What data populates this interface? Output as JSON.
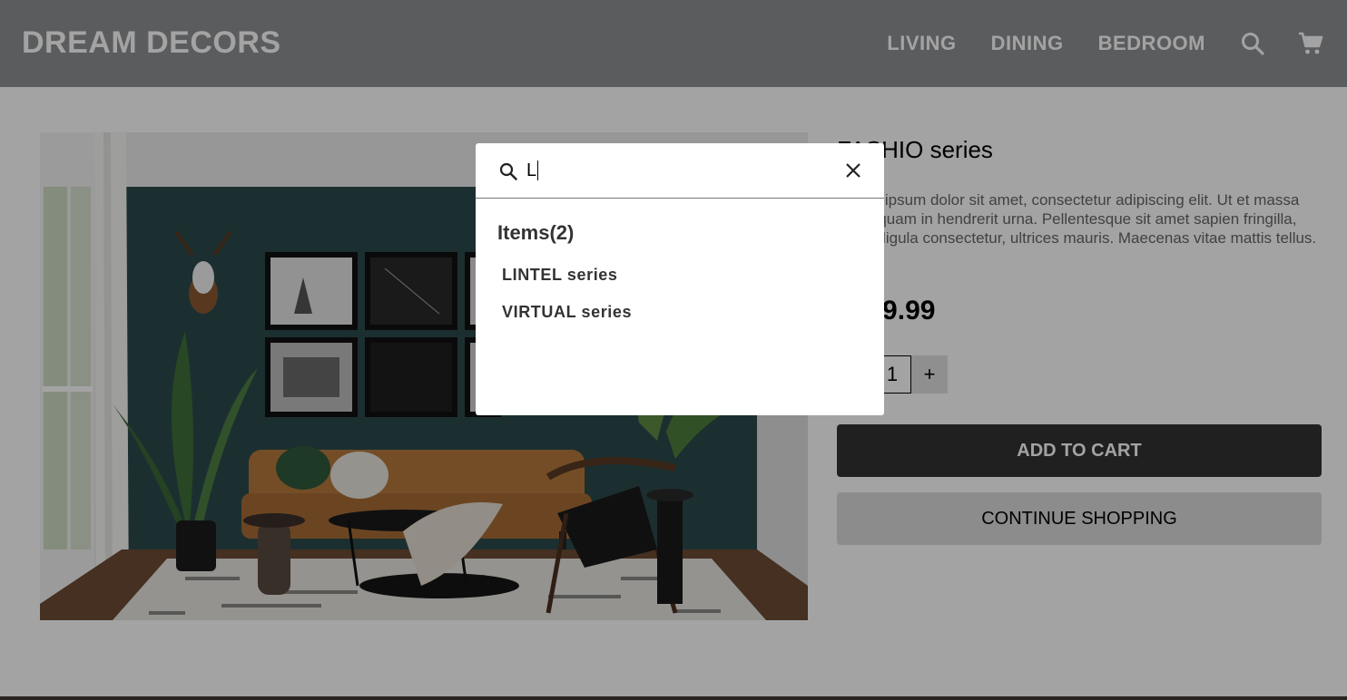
{
  "brand": {
    "logo": "DREAM DECORS"
  },
  "nav": {
    "items": [
      {
        "label": "LIVING"
      },
      {
        "label": "DINING"
      },
      {
        "label": "BEDROOM"
      }
    ],
    "search_icon": "search-icon",
    "cart_icon": "cart-icon"
  },
  "product": {
    "image_alt": "living-room-photo",
    "title": "FASHIO series",
    "description": "Lorem ipsum dolor sit amet, consectetur adipiscing elit. Ut et massa mi. Aliquam in hendrerit urna. Pellentesque sit amet sapien fringilla, mattis ligula consectetur, ultrices mauris. Maecenas vitae mattis tellus.",
    "price": "$599.99",
    "quantity": "1",
    "decrement_label": "−",
    "increment_label": "+",
    "add_to_cart_label": "ADD TO CART",
    "continue_label": "CONTINUE SHOPPING"
  },
  "search": {
    "query": "L",
    "results_heading": "Items(2)",
    "results": [
      {
        "label": "LINTEL series"
      },
      {
        "label": "VIRTUAL series"
      }
    ]
  },
  "colors": {
    "header_bg": "#8f9094",
    "wall": "#2c4a4b",
    "sofa": "#b6793e",
    "primary_button": "#333333"
  }
}
